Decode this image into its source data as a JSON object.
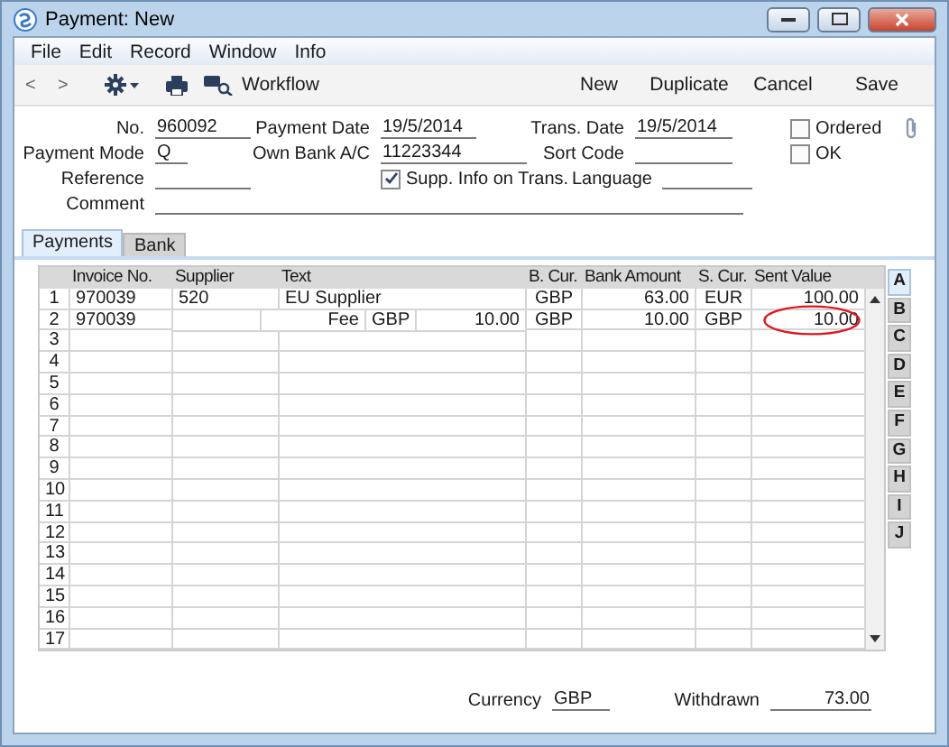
{
  "window": {
    "title": "Payment: New"
  },
  "menu": [
    "File",
    "Edit",
    "Record",
    "Window",
    "Info"
  ],
  "toolbar": {
    "prev": "<",
    "next": ">",
    "workflow": "Workflow",
    "actions": [
      "New",
      "Duplicate",
      "Cancel",
      "Save"
    ]
  },
  "header": {
    "no": {
      "label": "No.",
      "value": "960092"
    },
    "payment_mode": {
      "label": "Payment Mode",
      "value": "Q"
    },
    "reference": {
      "label": "Reference"
    },
    "comment": {
      "label": "Comment"
    },
    "payment_date": {
      "label": "Payment Date",
      "value": "19/5/2014"
    },
    "own_bank": {
      "label": "Own Bank A/C",
      "value": "11223344"
    },
    "supp_info": {
      "label": "Supp. Info on Trans.",
      "checked": true
    },
    "trans_date": {
      "label": "Trans. Date",
      "value": "19/5/2014"
    },
    "sort_code": {
      "label": "Sort Code"
    },
    "language": {
      "label": "Language"
    },
    "ordered": {
      "label": "Ordered",
      "checked": false
    },
    "ok": {
      "label": "OK",
      "checked": false
    }
  },
  "tabs": [
    {
      "label": "Payments",
      "selected": true
    },
    {
      "label": "Bank",
      "selected": false
    }
  ],
  "table": {
    "columns": [
      "Invoice No.",
      "Supplier",
      "Text",
      "B. Cur.",
      "Bank Amount",
      "S. Cur.",
      "Sent Value"
    ],
    "rows": [
      {
        "number": "1",
        "kind": "normal",
        "invoice": "970039",
        "supplier": "520",
        "text": "EU Supplier",
        "b_cur": "GBP",
        "bank_amount": "63.00",
        "s_cur": "EUR",
        "sent_value": "100.00",
        "circled": false
      },
      {
        "number": "2",
        "kind": "split",
        "invoice": "970039",
        "fee_label": "Fee",
        "fee_currency": "GBP",
        "fee_amount": "10.00",
        "b_cur": "GBP",
        "bank_amount": "10.00",
        "s_cur": "GBP",
        "sent_value": "10.00",
        "circled": true
      },
      {
        "number": "3",
        "kind": "empty"
      },
      {
        "number": "4",
        "kind": "empty"
      },
      {
        "number": "5",
        "kind": "empty"
      },
      {
        "number": "6",
        "kind": "empty"
      },
      {
        "number": "7",
        "kind": "empty"
      },
      {
        "number": "8",
        "kind": "empty"
      },
      {
        "number": "9",
        "kind": "empty"
      },
      {
        "number": "10",
        "kind": "empty"
      },
      {
        "number": "11",
        "kind": "empty"
      },
      {
        "number": "12",
        "kind": "empty"
      },
      {
        "number": "13",
        "kind": "empty"
      },
      {
        "number": "14",
        "kind": "empty"
      },
      {
        "number": "15",
        "kind": "empty"
      },
      {
        "number": "16",
        "kind": "empty"
      },
      {
        "number": "17",
        "kind": "empty"
      }
    ]
  },
  "side_tabs": [
    {
      "label": "A",
      "selected": true
    },
    {
      "label": "B",
      "selected": false
    },
    {
      "label": "C",
      "selected": false
    },
    {
      "label": "D",
      "selected": false
    },
    {
      "label": "E",
      "selected": false
    },
    {
      "label": "F",
      "selected": false
    },
    {
      "label": "G",
      "selected": false
    },
    {
      "label": "H",
      "selected": false
    },
    {
      "label": "I",
      "selected": false
    },
    {
      "label": "J",
      "selected": false
    }
  ],
  "footer": {
    "currency": {
      "label": "Currency",
      "value": "GBP"
    },
    "withdrawn": {
      "label": "Withdrawn",
      "value": "73.00"
    }
  }
}
